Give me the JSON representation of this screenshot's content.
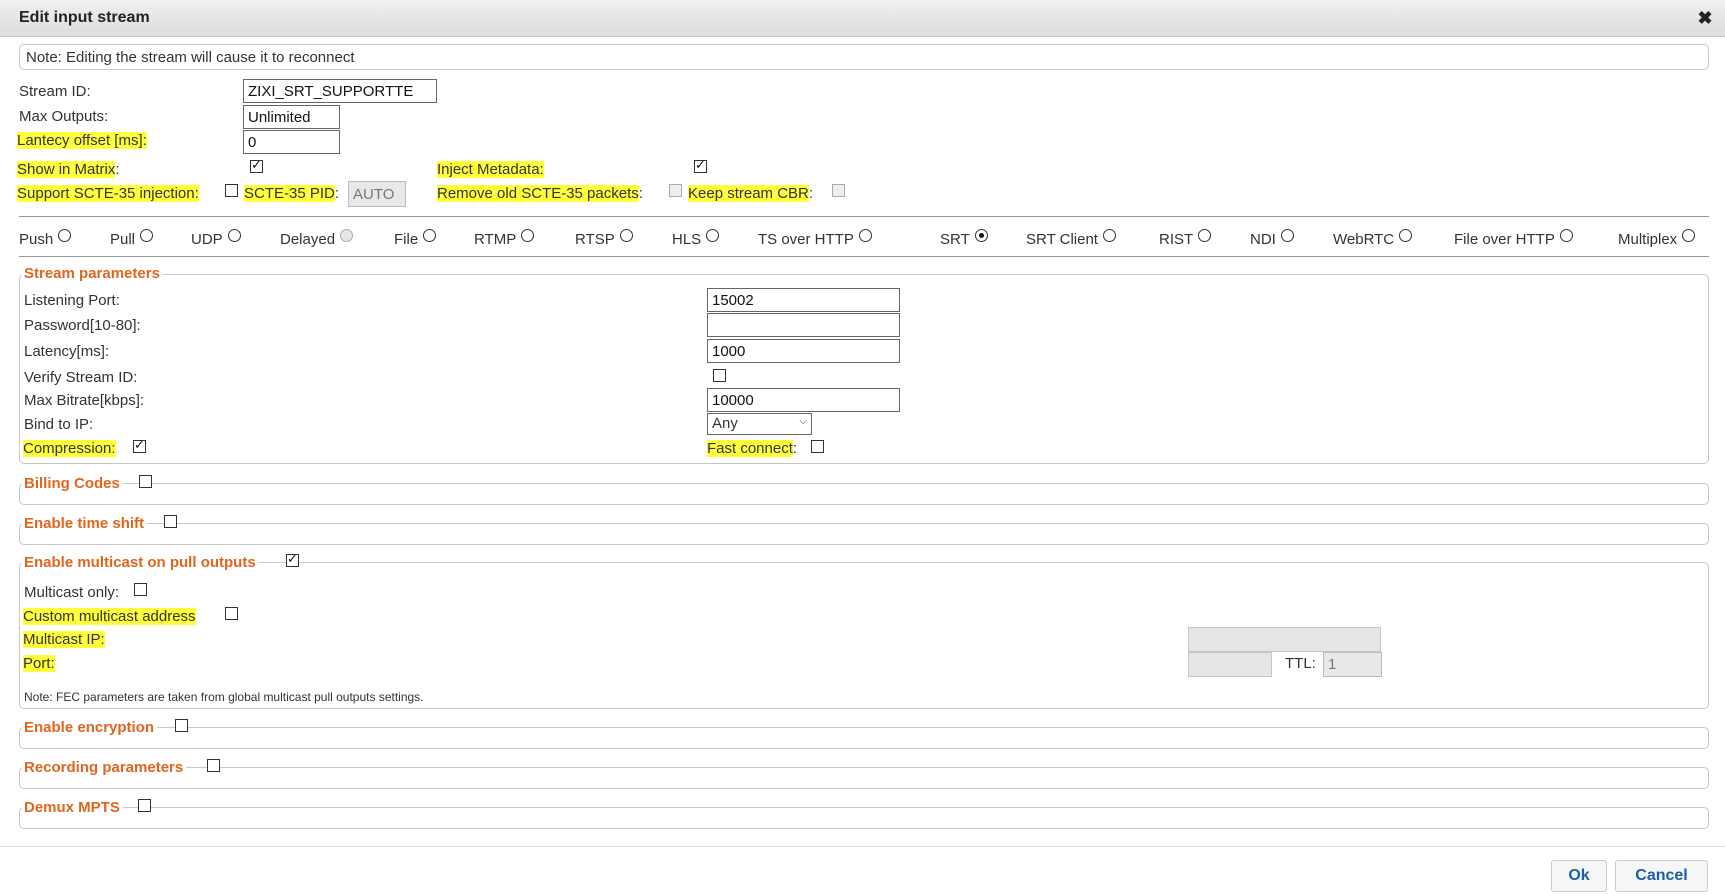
{
  "dialog": {
    "title": "Edit input stream"
  },
  "note": "Note: Editing the stream will cause it to reconnect",
  "general": {
    "stream_id_label": "Stream ID:",
    "stream_id_value": "ZIXI_SRT_SUPPORTTE",
    "max_outputs_label": "Max Outputs:",
    "max_outputs_value": "Unlimited",
    "latency_offset_label": "Lantecy offset [ms]:",
    "latency_offset_value": "0",
    "show_in_matrix_label": "Show in Matrix",
    "show_in_matrix_colon": ":",
    "show_in_matrix_checked": true,
    "inject_metadata_label": "Inject Metadata:",
    "inject_metadata_checked": true,
    "scte35_injection_label": "Support SCTE-35 injection:",
    "scte35_pid_label": "SCTE-35 PID",
    "scte35_pid_colon": ":",
    "scte35_pid_value": "AUTO",
    "remove_old_scte35_label": "Remove old SCTE-35 packets",
    "remove_old_colon": ":",
    "keep_cbr_label": "Keep stream CBR",
    "keep_cbr_colon": ":"
  },
  "stream_types": [
    {
      "label": "Push",
      "selected": false
    },
    {
      "label": "Pull",
      "selected": false
    },
    {
      "label": "UDP",
      "selected": false
    },
    {
      "label": "Delayed",
      "selected": false,
      "disabled": true
    },
    {
      "label": "File",
      "selected": false
    },
    {
      "label": "RTMP",
      "selected": false
    },
    {
      "label": "RTSP",
      "selected": false
    },
    {
      "label": "HLS",
      "selected": false
    },
    {
      "label": "TS over HTTP",
      "selected": false
    },
    {
      "label": "SRT",
      "selected": true
    },
    {
      "label": "SRT Client",
      "selected": false
    },
    {
      "label": "RIST",
      "selected": false
    },
    {
      "label": "NDI",
      "selected": false
    },
    {
      "label": "WebRTC",
      "selected": false
    },
    {
      "label": "File over HTTP",
      "selected": false
    },
    {
      "label": "Multiplex",
      "selected": false
    }
  ],
  "stream_params": {
    "legend": "Stream parameters",
    "listening_port_label": "Listening Port:",
    "listening_port_value": "15002",
    "password_label": "Password[10-80]:",
    "password_value": "",
    "latency_label": "Latency[ms]:",
    "latency_value": "1000",
    "verify_id_label": "Verify Stream ID:",
    "max_bitrate_label": "Max Bitrate[kbps]:",
    "max_bitrate_value": "10000",
    "bind_ip_label": "Bind to IP:",
    "bind_ip_value": "Any",
    "compression_label": "Compression:",
    "compression_checked": true,
    "fast_connect_label": "Fast connect",
    "fast_connect_colon": ":"
  },
  "billing": {
    "legend": "Billing Codes"
  },
  "time_shift": {
    "legend": "Enable time shift"
  },
  "multicast": {
    "legend": "Enable multicast on pull outputs",
    "enabled": true,
    "multicast_only_label": "Multicast only:",
    "custom_address_label": "Custom multicast address",
    "ip_label": "Multicast IP:",
    "port_label": "Port:",
    "ttl_label": "TTL:",
    "ttl_value": "1",
    "note": "Note: FEC parameters are taken from global multicast pull outputs settings."
  },
  "encryption": {
    "legend": "Enable encryption"
  },
  "recording": {
    "legend": "Recording parameters"
  },
  "demux": {
    "legend": "Demux MPTS"
  },
  "buttons": {
    "ok": "Ok",
    "cancel": "Cancel"
  }
}
